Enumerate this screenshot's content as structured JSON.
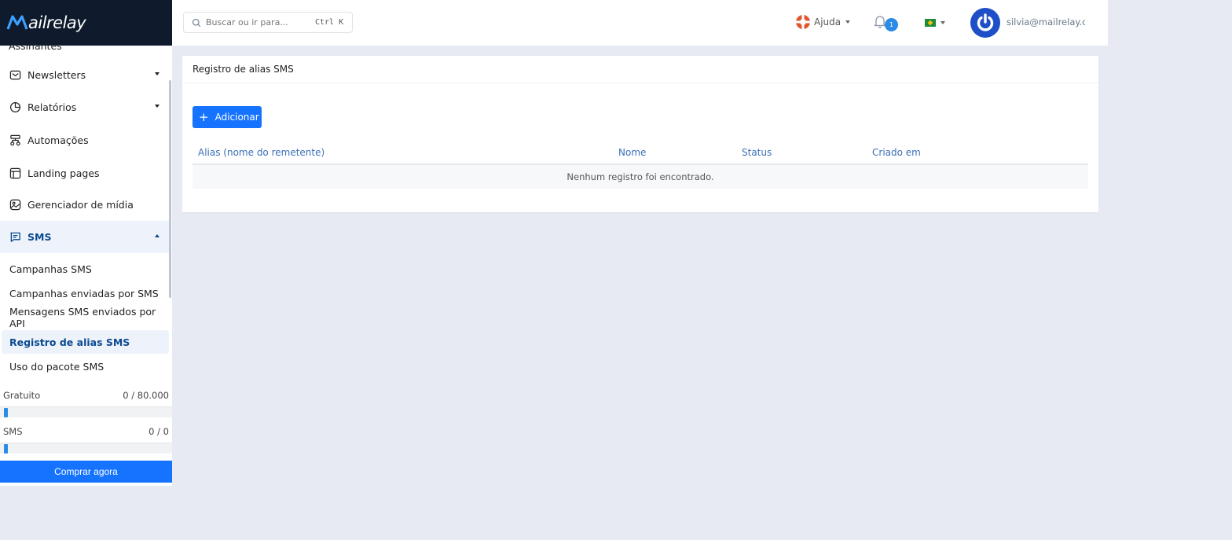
{
  "brand": {
    "name": "ailrelay"
  },
  "sidebar": {
    "partial_item": "Assinantes",
    "items": [
      {
        "label": "Newsletters",
        "icon": "envelope-icon",
        "expanded": false
      },
      {
        "label": "Relatórios",
        "icon": "pie-chart-icon",
        "expanded": false
      },
      {
        "label": "Automações",
        "icon": "flow-icon"
      },
      {
        "label": "Landing pages",
        "icon": "layout-icon"
      },
      {
        "label": "Gerenciador de mídia",
        "icon": "image-icon"
      },
      {
        "label": "SMS",
        "icon": "message-icon",
        "expanded": true
      }
    ],
    "sms_subitems": [
      {
        "label": "Campanhas SMS"
      },
      {
        "label": "Campanhas enviadas por SMS"
      },
      {
        "label": "Mensagens SMS enviados por API"
      },
      {
        "label": "Registro de alias SMS",
        "current": true
      },
      {
        "label": "Uso do pacote SMS"
      }
    ],
    "quotas": [
      {
        "label": "Gratuito",
        "value": "0 / 80.000",
        "fraction": 0
      },
      {
        "label": "SMS",
        "value": "0 / 0",
        "fraction": 0
      }
    ],
    "buy_label": "Comprar agora"
  },
  "topbar": {
    "search_placeholder": "Buscar ou ir para...",
    "search_shortcut": "Ctrl K",
    "help_label": "Ajuda",
    "notifications_count": "1",
    "language_flag": "brazil-flag-icon",
    "user_email": "silvia@mailrelay.com"
  },
  "content": {
    "card_title": "Registro de alias SMS",
    "add_label": "Adicionar",
    "columns": [
      "Alias (nome do remetente)",
      "Nome",
      "Status",
      "Criado em"
    ],
    "empty_message": "Nenhum registro foi encontrado."
  },
  "colors": {
    "primary": "#1573ff",
    "sidebar_dark": "#0f1b2d",
    "active_text": "#0b4a8f",
    "link": "#3b6fb6",
    "background": "#e7eaf3"
  }
}
